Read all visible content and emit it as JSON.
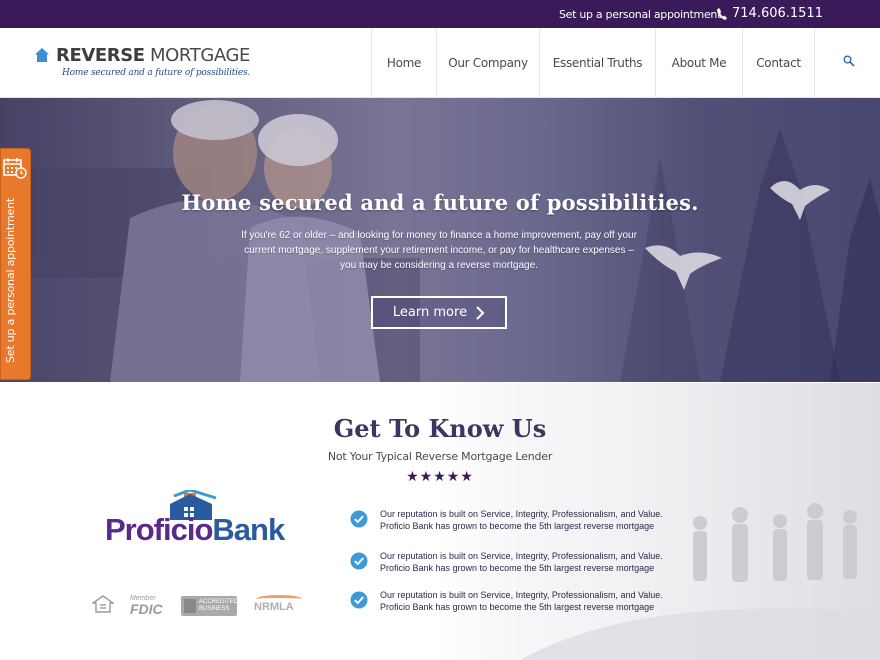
{
  "topbar": {
    "appointment_link": "Set up a personal appointment",
    "phone": "714.606.1511",
    "phone_icon": "phone-icon"
  },
  "header": {
    "logo": {
      "brand_bold": "REVERSE",
      "brand_light": " MORTGAGE",
      "tagline": "Home secured and a future of possibilities."
    },
    "nav": [
      {
        "label": "Home"
      },
      {
        "label": "Our Company"
      },
      {
        "label": "Essential Truths"
      },
      {
        "label": "About Me"
      },
      {
        "label": "Contact"
      }
    ],
    "search_icon": "search-icon"
  },
  "hero": {
    "title": "Home secured and a future of possibilities.",
    "text": "If you're 62 or older – and looking for money to finance a home improvement, pay off your current mortgage, supplement your retirement income, or pay for healthcare expenses – you may be considering a reverse mortgage.",
    "button_label": "Learn more"
  },
  "side_tab": {
    "label": "Set up a personal appointment",
    "icon": "calendar-icon"
  },
  "get_to_know": {
    "title": "Get To Know Us",
    "subtitle": "Not Your Typical Reverse Mortgage Lender",
    "stars": "★★★★★",
    "rating": 5
  },
  "partner": {
    "name_part1": "Proficio",
    "name_part2": "Bank"
  },
  "badges": {
    "fdic_small": "Member",
    "fdic": "FDIC",
    "bbb": "ACCREDITED BUSINESS",
    "nrmla": "NRMLA"
  },
  "points": [
    {
      "line1": "Our reputation is built on Service, Integrity, Professionalism, and Value.",
      "line2": "Proficio Bank has grown to become the 5th largest reverse mortgage"
    },
    {
      "line1": "Our reputation is built on Service, Integrity, Professionalism, and Value.",
      "line2": "Proficio Bank has grown to become the 5th largest reverse mortgage"
    },
    {
      "line1": "Our reputation is built on Service, Integrity, Professionalism, and Value.",
      "line2": "Proficio Bank has grown to become the 5th largest reverse mortgage"
    }
  ],
  "colors": {
    "topbar": "#3a1a59",
    "side_tab": "#e8782a",
    "check": "#3e9ad6",
    "title": "#3d3462"
  }
}
